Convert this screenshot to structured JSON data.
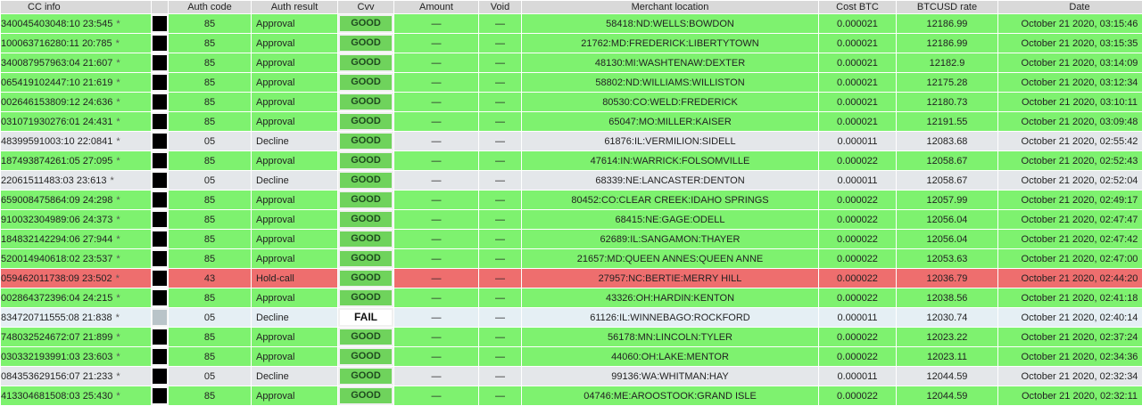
{
  "headers": [
    "CC info",
    "",
    "Auth code",
    "Auth result",
    "Cvv",
    "Amount",
    "Void",
    "Merchant location",
    "Cost BTC",
    "BTCUSD rate",
    "Date"
  ],
  "star": "*",
  "rows": [
    {
      "status": "approval",
      "cc": "340045403048:10 23:545",
      "auth": "85",
      "result": "Approval",
      "cvv": "GOOD",
      "amount": "—",
      "void": "—",
      "merchant": "58418:ND:WELLS:BOWDON",
      "cost": "0.000021",
      "rate": "12186.99",
      "date": "October 21 2020, 03:15:46"
    },
    {
      "status": "approval",
      "cc": "100063716280:11 20:785",
      "auth": "85",
      "result": "Approval",
      "cvv": "GOOD",
      "amount": "—",
      "void": "—",
      "merchant": "21762:MD:FREDERICK:LIBERTYTOWN",
      "cost": "0.000021",
      "rate": "12186.99",
      "date": "October 21 2020, 03:15:35"
    },
    {
      "status": "approval",
      "cc": "340087957963:04 21:607",
      "auth": "85",
      "result": "Approval",
      "cvv": "GOOD",
      "amount": "—",
      "void": "—",
      "merchant": "48130:MI:WASHTENAW:DEXTER",
      "cost": "0.000021",
      "rate": "12182.9",
      "date": "October 21 2020, 03:14:09"
    },
    {
      "status": "approval",
      "cc": "065419102447:10 21:619",
      "auth": "85",
      "result": "Approval",
      "cvv": "GOOD",
      "amount": "—",
      "void": "—",
      "merchant": "58802:ND:WILLIAMS:WILLISTON",
      "cost": "0.000021",
      "rate": "12175.28",
      "date": "October 21 2020, 03:12:34"
    },
    {
      "status": "approval",
      "cc": "002646153809:12 24:636",
      "auth": "85",
      "result": "Approval",
      "cvv": "GOOD",
      "amount": "—",
      "void": "—",
      "merchant": "80530:CO:WELD:FREDERICK",
      "cost": "0.000021",
      "rate": "12180.73",
      "date": "October 21 2020, 03:10:11"
    },
    {
      "status": "approval",
      "cc": "031071930276:01 24:431",
      "auth": "85",
      "result": "Approval",
      "cvv": "GOOD",
      "amount": "—",
      "void": "—",
      "merchant": "65047:MO:MILLER:KAISER",
      "cost": "0.000021",
      "rate": "12191.55",
      "date": "October 21 2020, 03:09:48"
    },
    {
      "status": "decline",
      "cc": "48399591003:10 22:0841",
      "auth": "05",
      "result": "Decline",
      "cvv": "GOOD",
      "amount": "—",
      "void": "—",
      "merchant": "61876:IL:VERMILION:SIDELL",
      "cost": "0.000011",
      "rate": "12083.68",
      "date": "October 21 2020, 02:55:42"
    },
    {
      "status": "approval",
      "cc": "187493874261:05 27:095",
      "auth": "85",
      "result": "Approval",
      "cvv": "GOOD",
      "amount": "—",
      "void": "—",
      "merchant": "47614:IN:WARRICK:FOLSOMVILLE",
      "cost": "0.000022",
      "rate": "12058.67",
      "date": "October 21 2020, 02:52:43"
    },
    {
      "status": "decline",
      "cc": "22061511483:03 23:613",
      "auth": "05",
      "result": "Decline",
      "cvv": "GOOD",
      "amount": "—",
      "void": "—",
      "merchant": "68339:NE:LANCASTER:DENTON",
      "cost": "0.000011",
      "rate": "12058.67",
      "date": "October 21 2020, 02:52:04"
    },
    {
      "status": "approval",
      "cc": "659008475864:09 24:298",
      "auth": "85",
      "result": "Approval",
      "cvv": "GOOD",
      "amount": "—",
      "void": "—",
      "merchant": "80452:CO:CLEAR CREEK:IDAHO SPRINGS",
      "cost": "0.000022",
      "rate": "12057.99",
      "date": "October 21 2020, 02:49:17"
    },
    {
      "status": "approval",
      "cc": "910032304989:06 24:373",
      "auth": "85",
      "result": "Approval",
      "cvv": "GOOD",
      "amount": "—",
      "void": "—",
      "merchant": "68415:NE:GAGE:ODELL",
      "cost": "0.000022",
      "rate": "12056.04",
      "date": "October 21 2020, 02:47:47"
    },
    {
      "status": "approval",
      "cc": "184832142294:06 27:944",
      "auth": "85",
      "result": "Approval",
      "cvv": "GOOD",
      "amount": "—",
      "void": "—",
      "merchant": "62689:IL:SANGAMON:THAYER",
      "cost": "0.000022",
      "rate": "12056.04",
      "date": "October 21 2020, 02:47:42"
    },
    {
      "status": "approval",
      "cc": "520014940618:02 23:537",
      "auth": "85",
      "result": "Approval",
      "cvv": "GOOD",
      "amount": "—",
      "void": "—",
      "merchant": "21657:MD:QUEEN ANNES:QUEEN ANNE",
      "cost": "0.000022",
      "rate": "12053.63",
      "date": "October 21 2020, 02:47:00"
    },
    {
      "status": "holdcall",
      "cc": "059462011738:09 23:502",
      "auth": "43",
      "result": "Hold-call",
      "cvv": "GOOD",
      "amount": "—",
      "void": "—",
      "merchant": "27957:NC:BERTIE:MERRY HILL",
      "cost": "0.000022",
      "rate": "12036.79",
      "date": "October 21 2020, 02:44:20"
    },
    {
      "status": "approval",
      "cc": "002864372396:04 24:215",
      "auth": "85",
      "result": "Approval",
      "cvv": "GOOD",
      "amount": "—",
      "void": "—",
      "merchant": "43326:OH:HARDIN:KENTON",
      "cost": "0.000022",
      "rate": "12038.56",
      "date": "October 21 2020, 02:41:18"
    },
    {
      "status": "fail",
      "cc": "834720711555:08 21:838",
      "auth": "05",
      "result": "Decline",
      "cvv": "FAIL",
      "amount": "—",
      "void": "—",
      "merchant": "61126:IL:WINNEBAGO:ROCKFORD",
      "cost": "0.000011",
      "rate": "12030.74",
      "date": "October 21 2020, 02:40:14"
    },
    {
      "status": "approval",
      "cc": "748032524672:07 21:899",
      "auth": "85",
      "result": "Approval",
      "cvv": "GOOD",
      "amount": "—",
      "void": "—",
      "merchant": "56178:MN:LINCOLN:TYLER",
      "cost": "0.000022",
      "rate": "12023.22",
      "date": "October 21 2020, 02:37:24"
    },
    {
      "status": "approval",
      "cc": "030332193991:03 23:603",
      "auth": "85",
      "result": "Approval",
      "cvv": "GOOD",
      "amount": "—",
      "void": "—",
      "merchant": "44060:OH:LAKE:MENTOR",
      "cost": "0.000022",
      "rate": "12023.11",
      "date": "October 21 2020, 02:34:36"
    },
    {
      "status": "decline",
      "cc": "084353629156:07 21:233",
      "auth": "05",
      "result": "Decline",
      "cvv": "GOOD",
      "amount": "—",
      "void": "—",
      "merchant": "99136:WA:WHITMAN:HAY",
      "cost": "0.000011",
      "rate": "12044.59",
      "date": "October 21 2020, 02:32:34"
    },
    {
      "status": "approval",
      "cc": "413304681508:03 25:430",
      "auth": "85",
      "result": "Approval",
      "cvv": "GOOD",
      "amount": "—",
      "void": "—",
      "merchant": "04746:ME:AROOSTOOK:GRAND ISLE",
      "cost": "0.000022",
      "rate": "12044.59",
      "date": "October 21 2020, 02:32:11"
    }
  ]
}
